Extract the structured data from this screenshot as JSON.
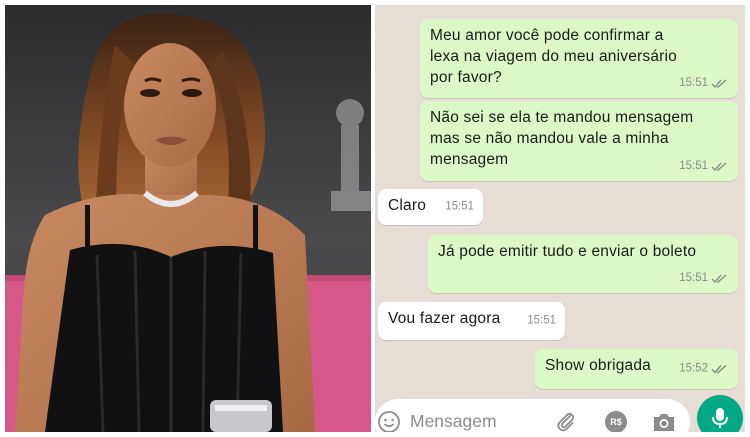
{
  "photo": {
    "caption": ""
  },
  "chat": {
    "messages": [
      {
        "direction": "out",
        "text": "Meu amor você pode confirmar a lexa na viagem do meu aniversário por favor?",
        "lines": [
          "Meu amor você pode confirmar a",
          "lexa na viagem do meu aniversário",
          "por favor?"
        ],
        "time": "15:51",
        "status": "read"
      },
      {
        "direction": "out",
        "lines": [
          "Não sei se ela te mandou mensagem",
          "mas se não mandou vale a minha",
          "mensagem"
        ],
        "time": "15:51",
        "status": "read"
      },
      {
        "direction": "in",
        "lines": [
          "Claro"
        ],
        "time": "15:51"
      },
      {
        "direction": "out",
        "lines": [
          "Já pode emitir tudo e enviar o boleto"
        ],
        "time": "15:51",
        "status": "read"
      },
      {
        "direction": "in",
        "lines": [
          "Vou fazer agora"
        ],
        "time": "15:51"
      },
      {
        "direction": "out",
        "lines": [
          "Show obrigada"
        ],
        "time": "15:52",
        "status": "read"
      }
    ],
    "input": {
      "placeholder": "Mensagem",
      "currency_label": "R$"
    },
    "icons": {
      "emoji": "emoji-icon",
      "attach": "paperclip-icon",
      "payment": "currency-icon",
      "camera": "camera-icon",
      "send": "microphone-icon",
      "status": "double-check-icon"
    },
    "colors": {
      "outgoing_bubble": "#dcf8c6",
      "incoming_bubble": "#ffffff",
      "background": "#e6ddd4",
      "accent": "#00a884"
    }
  }
}
